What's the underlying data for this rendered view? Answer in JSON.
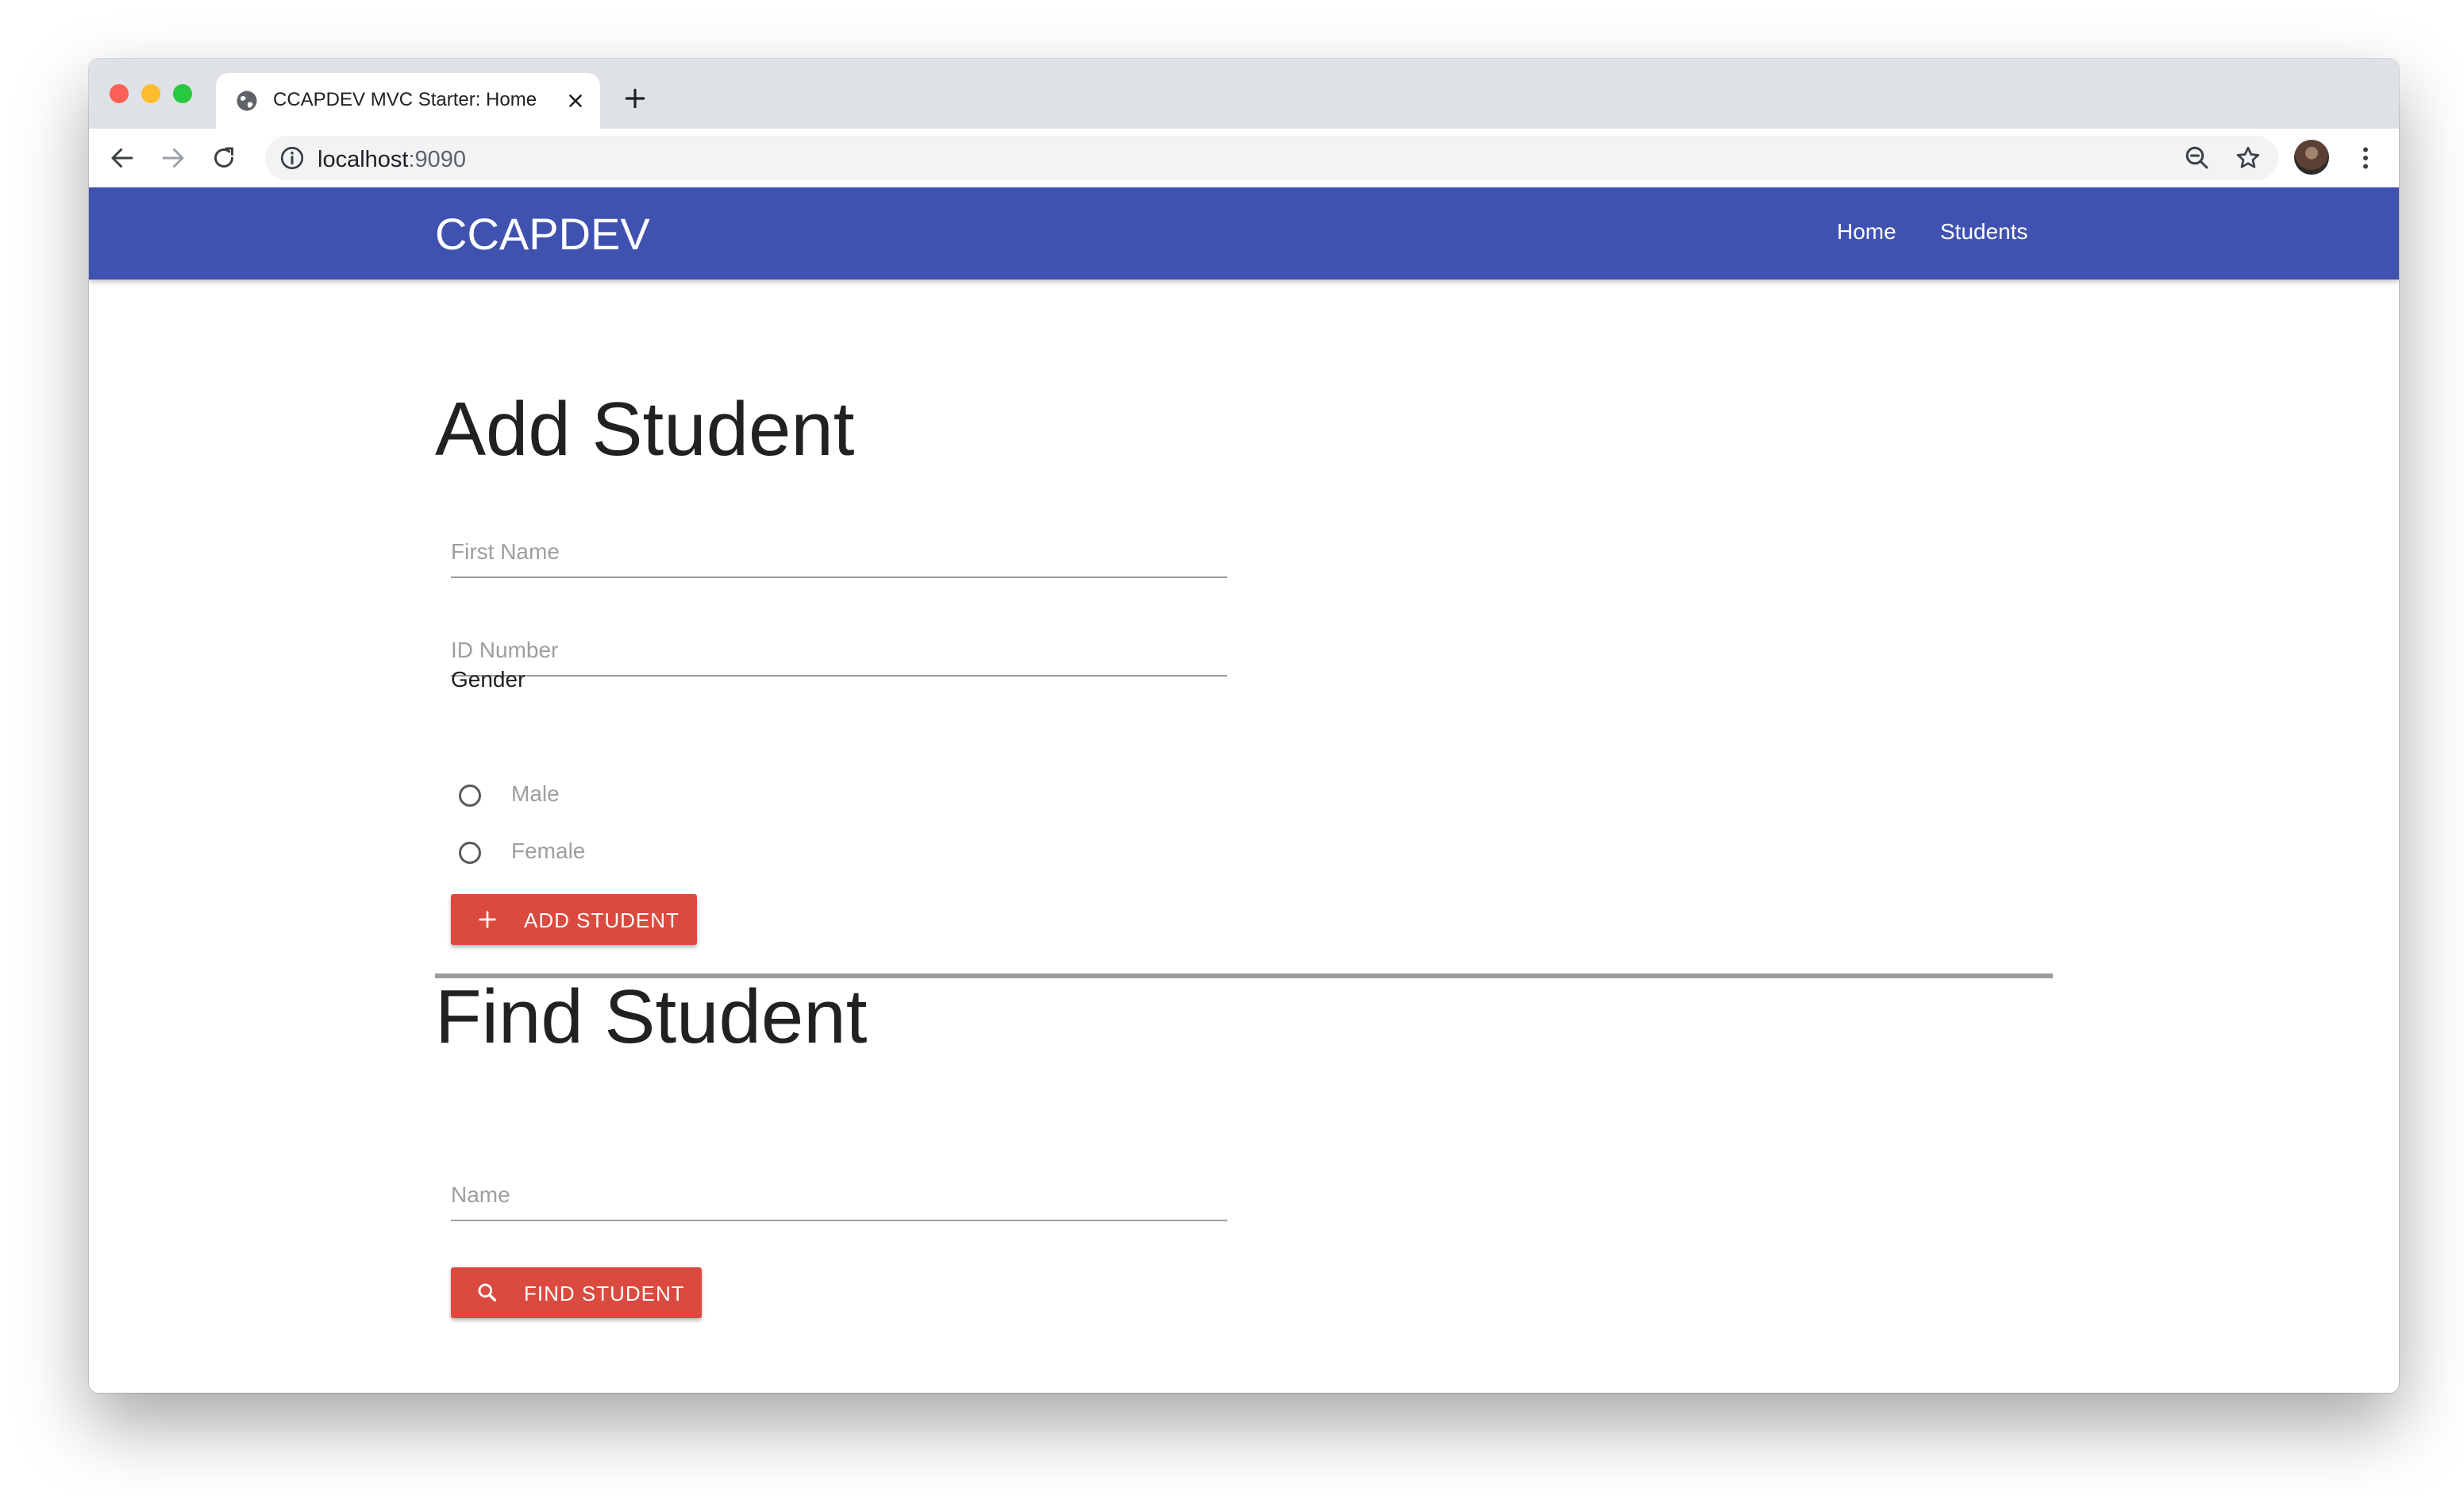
{
  "browser": {
    "tab_title": "CCAPDEV MVC Starter: Home",
    "url_host": "localhost",
    "url_port": ":9090"
  },
  "navbar": {
    "brand": "CCAPDEV",
    "links": [
      "Home",
      "Students"
    ]
  },
  "add_student": {
    "heading": "Add Student",
    "first_name_placeholder": "First Name",
    "id_number_placeholder": "ID Number",
    "gender_label": "Gender",
    "gender_options": [
      "Male",
      "Female"
    ],
    "submit_label": "ADD STUDENT"
  },
  "find_student": {
    "heading": "Find Student",
    "name_placeholder": "Name",
    "submit_label": "FIND STUDENT"
  },
  "colors": {
    "navbar": "#4052b0",
    "button": "#db4a3f"
  },
  "icons": [
    "globe-icon",
    "close-icon",
    "plus-icon",
    "back-icon",
    "forward-icon",
    "reload-icon",
    "info-icon",
    "zoom-out-icon",
    "star-icon",
    "menu-icon",
    "add-icon",
    "search-icon"
  ]
}
